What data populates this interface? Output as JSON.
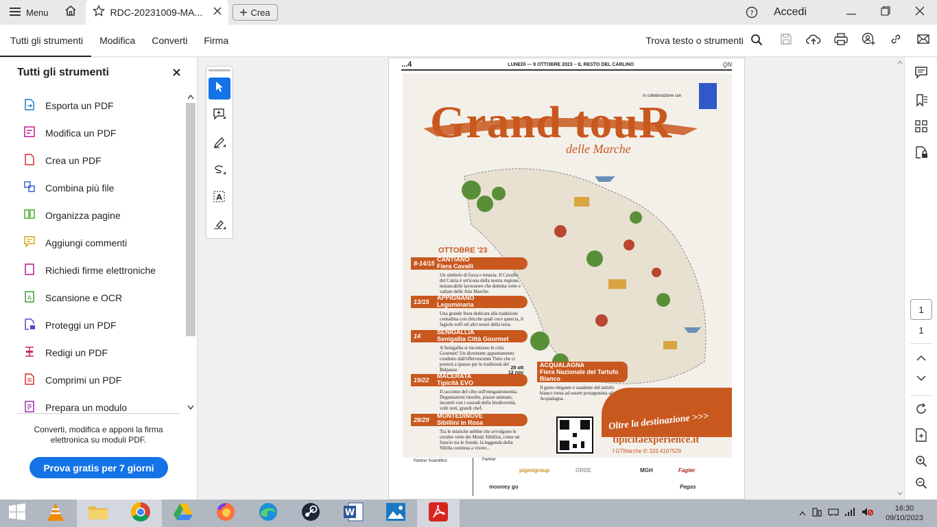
{
  "titlebar": {
    "menu_label": "Menu",
    "tab_title": "RDC-20231009-MA...",
    "create_label": "Crea",
    "signin_label": "Accedi"
  },
  "toolbar": {
    "tabs": [
      "Tutti gli strumenti",
      "Modifica",
      "Converti",
      "Firma"
    ],
    "find_label": "Trova testo o strumenti"
  },
  "left_panel": {
    "title": "Tutti gli strumenti",
    "items": [
      {
        "label": "Esporta un PDF",
        "color": "#1a7fc9"
      },
      {
        "label": "Modifica un PDF",
        "color": "#c4168f"
      },
      {
        "label": "Crea un PDF",
        "color": "#d62d2d"
      },
      {
        "label": "Combina più file",
        "color": "#3b5fd6"
      },
      {
        "label": "Organizza pagine",
        "color": "#4caa2c"
      },
      {
        "label": "Aggiungi commenti",
        "color": "#d4a514"
      },
      {
        "label": "Richiedi firme elettroniche",
        "color": "#b01c8c"
      },
      {
        "label": "Scansione e OCR",
        "color": "#3a9a3a"
      },
      {
        "label": "Proteggi un PDF",
        "color": "#5a46c8"
      },
      {
        "label": "Redigi un PDF",
        "color": "#c8246a"
      },
      {
        "label": "Comprimi un PDF",
        "color": "#d62d2d"
      },
      {
        "label": "Prepara un modulo",
        "color": "#9a2ca8"
      }
    ],
    "promo_text": "Converti, modifica e apponi la firma elettronica su moduli PDF.",
    "cta_label": "Prova gratis per 7 giorni"
  },
  "document": {
    "page_number_label": "...4",
    "header_text": "LUNEDÌ — 9 OTTOBRE 2023 – IL RESTO DEL CARLINO",
    "header_qn": "QN",
    "poster": {
      "collab": "in collaborazione con",
      "title": "Grand touR",
      "subtitle": "delle Marche",
      "month": "OTTOBRE '23",
      "events": [
        {
          "dates": "8-14/15",
          "title": "CANTIANO",
          "title2": "Fiera Cavalli",
          "text": "Un simbolo di forza e tenacia. Il Cavallo del Catria è un'icona della nostra regione, instancabile lavoratore che domina vette e vallate delle Alte Marche."
        },
        {
          "dates": "13/15",
          "title": "APPIGNANO",
          "title2": "Leguminaria",
          "text": "Una grande festa dedicata alla tradizione contadina con chicche quali cece quercia, il fagiolo solfì ed altri tesori della terra."
        },
        {
          "dates": "14",
          "title": "SENIGALLIA",
          "title2": "Senigallia Città Gourmet",
          "text": "A Senigallia si incontrano le città Gourmet! Un divertente appuntamento condotto dall'effervescente Tinto che ci porterà a spasso per le tradizioni del Belpaese."
        },
        {
          "dates": "19/22",
          "title": "MACERATA",
          "title2": "Tipicità EVO",
          "text": "Il racconto del cibo sull'enogastronomia. Degustazioni insolite, piazze animate, incontri con i custodi della biodiversità, volti noti, grandi chef."
        },
        {
          "dates": "28/29",
          "title": "MONTEDINOVE",
          "title2": "Sibillini in Rosa",
          "text": "Tra le mistiche nebbie che avvolgono le cerulee vette dei Monti Sibillini, come un fruscio tra le fronde, la leggenda della Sibilla continua a vivere..."
        }
      ],
      "acqualagna": {
        "dates_a": "28 ott",
        "dates_b": "12 nov",
        "title": "ACQUALAGNA",
        "title2": "Fiera Nazionale del Tartufo Bianco",
        "text": "Il gusto elegante e suadente del tartufo bianco torna ad essere protagonista ad Acqualagna."
      },
      "band_text": "Oltre la destinazione >>>",
      "site": "tipicitaexperience.it",
      "social": "f GTMarche  ✆ 333.4167529",
      "partner_scientifico": "Partner Scientifico",
      "partner": "Partner",
      "partner_logos": [
        "pigmigroup",
        "ORDE",
        "MGH",
        "Fagter",
        "mooney go",
        "Pegas"
      ]
    }
  },
  "right_rail": {
    "current_page": "1",
    "total_pages": "1"
  },
  "taskbar": {
    "time": "16:30",
    "date": "09/10/2023"
  },
  "colors": {
    "accent": "#1473e6",
    "poster_orange": "#c8581e"
  }
}
